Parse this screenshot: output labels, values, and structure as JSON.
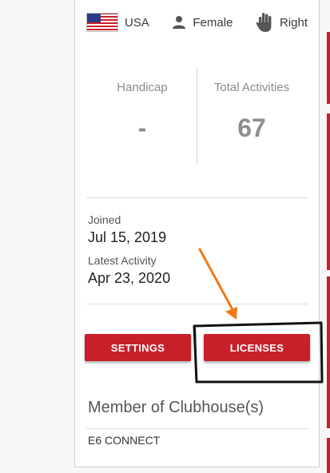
{
  "profile": {
    "country": "USA",
    "gender": "Female",
    "handedness": "Right"
  },
  "stats": {
    "handicap_label": "Handicap",
    "handicap_value": "-",
    "activities_label": "Total Activities",
    "activities_value": "67"
  },
  "dates": {
    "joined_label": "Joined",
    "joined_value": "Jul 15, 2019",
    "latest_label": "Latest Activity",
    "latest_value": "Apr 23, 2020"
  },
  "buttons": {
    "settings_label": "SETTINGS",
    "licenses_label": "LICENSES"
  },
  "clubhouse": {
    "title": "Member of Clubhouse(s)",
    "items": [
      "E6 CONNECT"
    ]
  },
  "colors": {
    "accent": "#c8202a",
    "annotation_arrow": "#f07a1a",
    "annotation_box": "#111111"
  },
  "icons": {
    "country": "us-flag-icon",
    "gender": "person-icon",
    "handedness": "hand-icon"
  }
}
